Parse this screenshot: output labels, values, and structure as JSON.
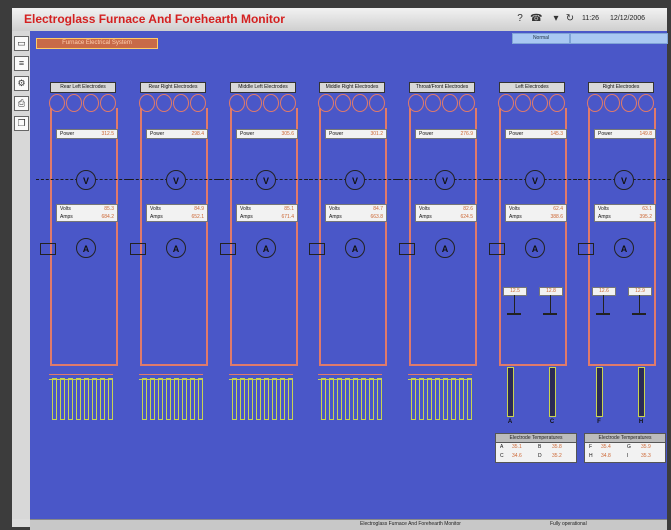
{
  "window": {
    "title": "Electroglass Furnace And Forehearth Monitor",
    "time": "11:26",
    "date": "12/12/2006"
  },
  "subtitle": "Furnace Electrical System",
  "top_strip": {
    "left": "Normal",
    "right": ""
  },
  "sidebar_icons": [
    "monitor-icon",
    "document-icon",
    "settings-icon",
    "print-icon",
    "copy-icon"
  ],
  "columns": [
    {
      "label": "Rear Left Electrodes",
      "power_label": "Power",
      "power": "312.5",
      "volts": "85.3",
      "amps": "684.2"
    },
    {
      "label": "Rear Right Electrodes",
      "power_label": "Power",
      "power": "298.4",
      "volts": "84.9",
      "amps": "652.1"
    },
    {
      "label": "Middle Left Electrodes",
      "power_label": "Power",
      "power": "305.6",
      "volts": "85.1",
      "amps": "671.4"
    },
    {
      "label": "Middle Right Electrodes",
      "power_label": "Power",
      "power": "301.2",
      "volts": "84.7",
      "amps": "663.8"
    },
    {
      "label": "Throat/Front Electrodes",
      "power_label": "Power",
      "power": "276.9",
      "volts": "82.6",
      "amps": "624.5"
    },
    {
      "label": "Left Electrodes",
      "power_label": "Power",
      "power": "145.3",
      "volts": "62.4",
      "amps": "388.6",
      "setpoints": [
        "12.5",
        "12.8"
      ],
      "electrodes": [
        "A",
        "C"
      ],
      "table": {
        "title": "Electrode Temperatures",
        "rows": [
          [
            "A",
            "35.1",
            "B",
            "35.8"
          ],
          [
            "C",
            "34.6",
            "D",
            "35.2"
          ]
        ]
      }
    },
    {
      "label": "Right Electrodes",
      "power_label": "Power",
      "power": "149.8",
      "volts": "63.1",
      "amps": "395.2",
      "setpoints": [
        "12.6",
        "12.9"
      ],
      "electrodes": [
        "F",
        "H"
      ],
      "table": {
        "title": "Electrode Temperatures",
        "rows": [
          [
            "F",
            "35.4",
            "G",
            "35.9"
          ],
          [
            "H",
            "34.8",
            "I",
            "35.3"
          ]
        ]
      }
    }
  ],
  "labels": {
    "volts": "Volts",
    "amps": "Amps",
    "v_symbol": "V",
    "a_symbol": "A"
  },
  "status": {
    "middle": "Electroglass Furnace And Forehearth Monitor",
    "right": "Fully operational"
  }
}
